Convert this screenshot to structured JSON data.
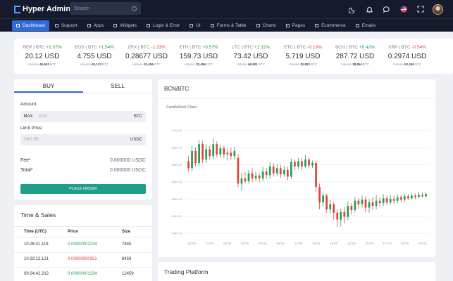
{
  "app": {
    "title": "Hyper Admin"
  },
  "search": {
    "placeholder": "Search"
  },
  "nav": [
    {
      "label": "Dashboard",
      "active": true
    },
    {
      "label": "Support"
    },
    {
      "label": "Apps"
    },
    {
      "label": "Widgets"
    },
    {
      "label": "Login & Error"
    },
    {
      "label": "UI"
    },
    {
      "label": "Forms & Table"
    },
    {
      "label": "Charts"
    },
    {
      "label": "Pages"
    },
    {
      "label": "Ecommerce"
    },
    {
      "label": "Emails"
    }
  ],
  "ticker": [
    {
      "pair": "REP | BTC",
      "change": "+2.57%",
      "trend": "up",
      "price": "20.12 USD",
      "volume_label": "Volume",
      "volume": "45,603",
      "unit": "BTC"
    },
    {
      "pair": "EOS | BTC",
      "change": "+1.54%",
      "trend": "up",
      "price": "4.755 USD",
      "volume_label": "Volume",
      "volume": "63,123",
      "unit": "BTC"
    },
    {
      "pair": "ZRX | BTC",
      "change": "-1.33%",
      "trend": "down",
      "price": "0.28677 USD",
      "volume_label": "Volume",
      "volume": "33,455",
      "unit": "BTC"
    },
    {
      "pair": "ETH | BTC",
      "change": "+0.57%",
      "trend": "up",
      "price": "159.73 USD",
      "volume_label": "Volume",
      "volume": "32,456",
      "unit": "BTC"
    },
    {
      "pair": "LTC | BTC",
      "change": "+1.32%",
      "trend": "up",
      "price": "73.42 USD",
      "volume_label": "Volume",
      "volume": "66,801",
      "unit": "BTC"
    },
    {
      "pair": "ETC | BTC",
      "change": "-0.19%",
      "trend": "down",
      "price": "5.719 USD",
      "volume_label": "Volume",
      "volume": "32,803",
      "unit": "BTC"
    },
    {
      "pair": "BCH | BTC",
      "change": "+0.42%",
      "trend": "up",
      "price": "287.72 USD",
      "volume_label": "Volume",
      "volume": "38,854",
      "unit": "BTC"
    },
    {
      "pair": "XRP | BTC",
      "change": "-0.54%",
      "trend": "down",
      "price": "0.2974 USD",
      "volume_label": "Volume",
      "volume": "52,345",
      "unit": "BTC"
    }
  ],
  "order": {
    "tab_buy": "BUY",
    "tab_sell": "SELL",
    "amount_label": "Amount",
    "max_label": "MAX",
    "amount_value": "0.00",
    "amount_currency": "BTC",
    "limit_label": "Limit Price",
    "limit_value": "3967.95",
    "limit_currency": "USDC",
    "fee_label": "Fee*",
    "fee_value": "0.000000 USDC",
    "total_label": "Total*",
    "total_value": "0.000000 USDC",
    "button": "PLACE ORDER"
  },
  "chart_card": {
    "title": "BCN/BTC",
    "subtitle": "CandleStick Chart"
  },
  "chart_data": {
    "type": "candlestick",
    "title": "CandleStick Chart",
    "x_tick_labels": [
      "20:00",
      "21:00",
      "00:00",
      "03:00",
      "06:00",
      "09:00",
      "12:00",
      "15:00",
      "18:00",
      "21:00",
      "00:00",
      "07 Oct",
      "03:00",
      "04:00"
    ],
    "y_tick_labels": [
      "6700.00",
      "6650.00",
      "6600.00",
      "6550.00",
      "6500.00",
      "6450.00",
      "6400.00"
    ],
    "ylim": [
      6390,
      6730
    ],
    "candles": [
      {
        "o": 6610,
        "c": 6590,
        "h": 6625,
        "l": 6580
      },
      {
        "o": 6590,
        "c": 6640,
        "h": 6655,
        "l": 6580
      },
      {
        "o": 6640,
        "c": 6605,
        "h": 6650,
        "l": 6595
      },
      {
        "o": 6605,
        "c": 6660,
        "h": 6672,
        "l": 6595
      },
      {
        "o": 6660,
        "c": 6615,
        "h": 6670,
        "l": 6605
      },
      {
        "o": 6615,
        "c": 6645,
        "h": 6660,
        "l": 6605
      },
      {
        "o": 6645,
        "c": 6625,
        "h": 6655,
        "l": 6615
      },
      {
        "o": 6625,
        "c": 6660,
        "h": 6675,
        "l": 6615
      },
      {
        "o": 6660,
        "c": 6630,
        "h": 6668,
        "l": 6622
      },
      {
        "o": 6630,
        "c": 6648,
        "h": 6658,
        "l": 6620
      },
      {
        "o": 6648,
        "c": 6630,
        "h": 6655,
        "l": 6620
      },
      {
        "o": 6630,
        "c": 6635,
        "h": 6648,
        "l": 6612
      },
      {
        "o": 6635,
        "c": 6625,
        "h": 6650,
        "l": 6614
      },
      {
        "o": 6625,
        "c": 6640,
        "h": 6652,
        "l": 6616
      },
      {
        "o": 6620,
        "c": 6545,
        "h": 6632,
        "l": 6535
      },
      {
        "o": 6545,
        "c": 6560,
        "h": 6575,
        "l": 6525
      },
      {
        "o": 6560,
        "c": 6552,
        "h": 6578,
        "l": 6545
      },
      {
        "o": 6552,
        "c": 6575,
        "h": 6585,
        "l": 6545
      },
      {
        "o": 6575,
        "c": 6560,
        "h": 6590,
        "l": 6550
      },
      {
        "o": 6560,
        "c": 6568,
        "h": 6580,
        "l": 6552
      },
      {
        "o": 6568,
        "c": 6560,
        "h": 6575,
        "l": 6548
      },
      {
        "o": 6560,
        "c": 6580,
        "h": 6594,
        "l": 6552
      },
      {
        "o": 6580,
        "c": 6570,
        "h": 6590,
        "l": 6558
      },
      {
        "o": 6570,
        "c": 6595,
        "h": 6608,
        "l": 6560
      },
      {
        "o": 6595,
        "c": 6575,
        "h": 6605,
        "l": 6565
      },
      {
        "o": 6575,
        "c": 6590,
        "h": 6602,
        "l": 6566
      },
      {
        "o": 6590,
        "c": 6572,
        "h": 6600,
        "l": 6562
      },
      {
        "o": 6572,
        "c": 6585,
        "h": 6596,
        "l": 6565
      },
      {
        "o": 6585,
        "c": 6565,
        "h": 6595,
        "l": 6555
      },
      {
        "o": 6565,
        "c": 6608,
        "h": 6618,
        "l": 6558
      },
      {
        "o": 6608,
        "c": 6595,
        "h": 6615,
        "l": 6585
      },
      {
        "o": 6595,
        "c": 6610,
        "h": 6620,
        "l": 6588
      },
      {
        "o": 6610,
        "c": 6595,
        "h": 6618,
        "l": 6585
      },
      {
        "o": 6595,
        "c": 6615,
        "h": 6628,
        "l": 6590
      },
      {
        "o": 6615,
        "c": 6598,
        "h": 6622,
        "l": 6590
      },
      {
        "o": 6598,
        "c": 6605,
        "h": 6612,
        "l": 6590
      },
      {
        "o": 6605,
        "c": 6535,
        "h": 6612,
        "l": 6520
      },
      {
        "o": 6535,
        "c": 6490,
        "h": 6545,
        "l": 6470
      },
      {
        "o": 6490,
        "c": 6510,
        "h": 6520,
        "l": 6478
      },
      {
        "o": 6510,
        "c": 6470,
        "h": 6515,
        "l": 6460
      },
      {
        "o": 6470,
        "c": 6485,
        "h": 6498,
        "l": 6458
      },
      {
        "o": 6485,
        "c": 6460,
        "h": 6492,
        "l": 6440
      },
      {
        "o": 6460,
        "c": 6440,
        "h": 6470,
        "l": 6418
      },
      {
        "o": 6440,
        "c": 6462,
        "h": 6472,
        "l": 6420
      },
      {
        "o": 6462,
        "c": 6448,
        "h": 6476,
        "l": 6428
      },
      {
        "o": 6448,
        "c": 6480,
        "h": 6492,
        "l": 6438
      },
      {
        "o": 6480,
        "c": 6468,
        "h": 6488,
        "l": 6455
      },
      {
        "o": 6468,
        "c": 6495,
        "h": 6506,
        "l": 6460
      },
      {
        "o": 6495,
        "c": 6485,
        "h": 6502,
        "l": 6472
      },
      {
        "o": 6485,
        "c": 6498,
        "h": 6510,
        "l": 6475
      },
      {
        "o": 6498,
        "c": 6475,
        "h": 6508,
        "l": 6462
      },
      {
        "o": 6475,
        "c": 6490,
        "h": 6500,
        "l": 6460
      },
      {
        "o": 6490,
        "c": 6480,
        "h": 6505,
        "l": 6468
      },
      {
        "o": 6480,
        "c": 6495,
        "h": 6512,
        "l": 6470
      },
      {
        "o": 6495,
        "c": 6488,
        "h": 6505,
        "l": 6478
      },
      {
        "o": 6488,
        "c": 6502,
        "h": 6514,
        "l": 6480
      },
      {
        "o": 6502,
        "c": 6490,
        "h": 6510,
        "l": 6482
      },
      {
        "o": 6490,
        "c": 6500,
        "h": 6512,
        "l": 6484
      },
      {
        "o": 6500,
        "c": 6495,
        "h": 6510,
        "l": 6486
      },
      {
        "o": 6495,
        "c": 6505,
        "h": 6514,
        "l": 6488
      },
      {
        "o": 6505,
        "c": 6498,
        "h": 6512,
        "l": 6490
      },
      {
        "o": 6498,
        "c": 6508,
        "h": 6516,
        "l": 6492
      },
      {
        "o": 6508,
        "c": 6502,
        "h": 6514,
        "l": 6496
      },
      {
        "o": 6502,
        "c": 6510,
        "h": 6518,
        "l": 6498
      },
      {
        "o": 6510,
        "c": 6506,
        "h": 6516,
        "l": 6500
      },
      {
        "o": 6506,
        "c": 6512,
        "h": 6520,
        "l": 6502
      },
      {
        "o": 6512,
        "c": 6508,
        "h": 6518,
        "l": 6504
      },
      {
        "o": 6508,
        "c": 6515,
        "h": 6520,
        "l": 6505
      }
    ]
  },
  "time_sales": {
    "title": "Time & Sales",
    "headers": [
      "Time (UTC)",
      "Price",
      "Size"
    ],
    "rows": [
      {
        "time": "10:26:41.119",
        "price": "0.00000001234",
        "trend": "up",
        "size": "7845"
      },
      {
        "time": "10:33:12.121",
        "price": "0.00000000951",
        "trend": "down",
        "size": "8459"
      },
      {
        "time": "09:24:42.212",
        "price": "0.00000001234",
        "trend": "up",
        "size": "12459"
      }
    ]
  },
  "trading": {
    "title": "Trading Platform"
  },
  "colors": {
    "accent": "#2f6bd9",
    "up": "#1fa25a",
    "down": "#e0463b",
    "order_button": "#1f9e8a",
    "topbar": "#151b2d"
  }
}
